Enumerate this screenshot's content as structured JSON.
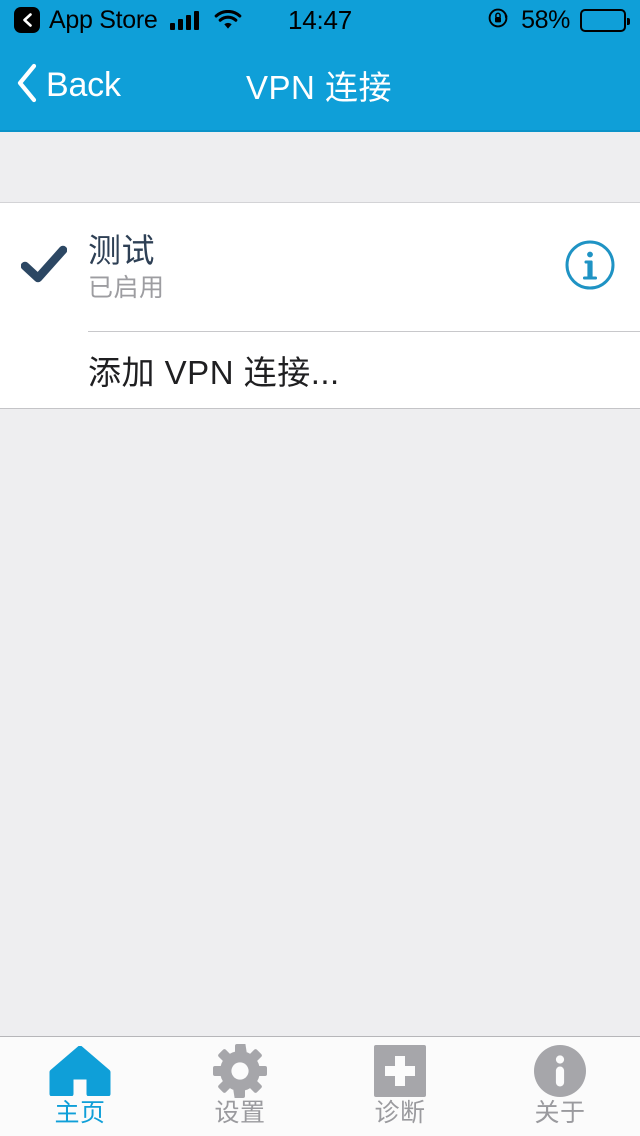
{
  "status_bar": {
    "back_app": "App Store",
    "back_icon": "chevron-left-icon",
    "signal_icon": "cellular-signal-icon",
    "signal_bars": 4,
    "wifi_icon": "wifi-icon",
    "time": "14:47",
    "rotation_lock_icon": "rotation-lock-icon",
    "battery_percent": "58%",
    "battery_level": 58,
    "battery_icon": "battery-icon"
  },
  "nav_bar": {
    "back_label": "Back",
    "back_icon": "chevron-left-icon",
    "title": "VPN 连接",
    "background_color": "#0f9fd8"
  },
  "list": {
    "items": [
      {
        "checked": true,
        "check_icon": "checkmark-icon",
        "title": "测试",
        "subtitle": "已启用",
        "info_icon": "info-circle-icon"
      }
    ],
    "add_label": "添加 VPN 连接..."
  },
  "tab_bar": {
    "active_color": "#0f9fd8",
    "inactive_color": "#9a9a9e",
    "tabs": [
      {
        "label": "主页",
        "icon": "home-icon",
        "active": true
      },
      {
        "label": "设置",
        "icon": "gear-icon",
        "active": false
      },
      {
        "label": "诊断",
        "icon": "plus-square-icon",
        "active": false
      },
      {
        "label": "关于",
        "icon": "info-circle-filled-icon",
        "active": false
      }
    ]
  }
}
